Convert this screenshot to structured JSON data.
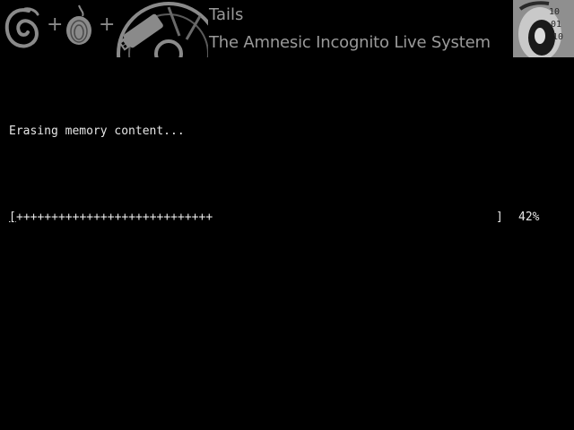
{
  "banner": {
    "title": "Tails",
    "subtitle": "The Amnesic Incognito Live System",
    "plus_signs": [
      "+",
      "+"
    ],
    "binary_digits": [
      "10",
      "01",
      "10"
    ],
    "logos": [
      "debian-swirl-icon",
      "tor-onion-icon",
      "usb-stick-cd-icon",
      "tails-mascot-icon"
    ]
  },
  "console": {
    "status_text": "Erasing memory content...",
    "progress": {
      "open_bracket": "[",
      "bar_text": "++++++++++++++++++++++++++++",
      "close_bracket": "]",
      "percent_text": "42%",
      "value": 0.42
    }
  },
  "colors": {
    "background": "#000000",
    "console_text": "#e6e6e6",
    "banner_gray": "#8a8a8a"
  }
}
